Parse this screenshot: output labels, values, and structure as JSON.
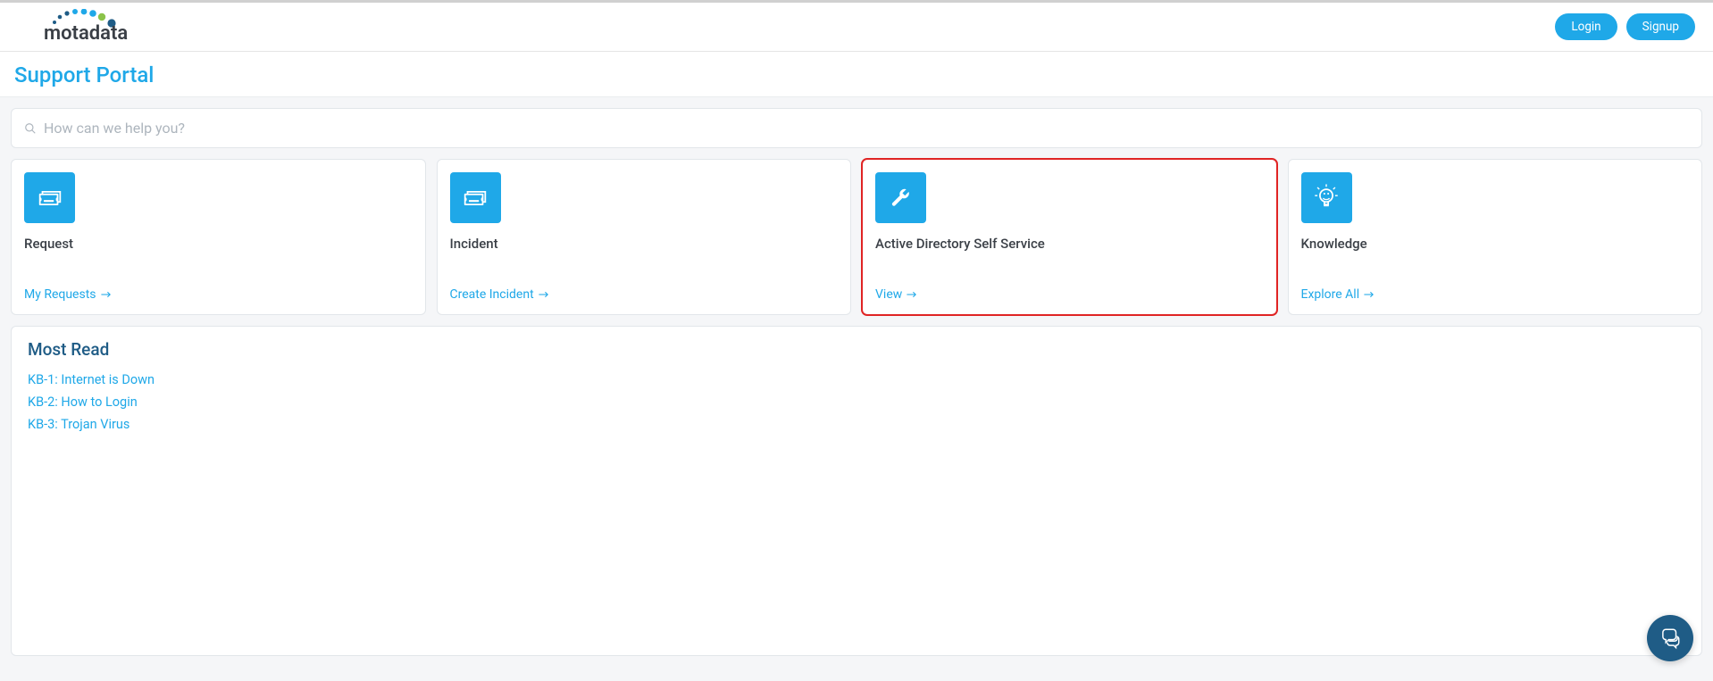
{
  "header": {
    "logo_text": "motadata",
    "login_label": "Login",
    "signup_label": "Signup"
  },
  "page": {
    "title": "Support Portal"
  },
  "search": {
    "placeholder": "How can we help you?"
  },
  "cards": [
    {
      "title": "Request",
      "link_label": "My Requests",
      "icon": "ticket"
    },
    {
      "title": "Incident",
      "link_label": "Create Incident",
      "icon": "ticket"
    },
    {
      "title": "Active Directory Self Service",
      "link_label": "View",
      "icon": "wrench",
      "highlighted": true
    },
    {
      "title": "Knowledge",
      "link_label": "Explore All",
      "icon": "lightbulb"
    }
  ],
  "most_read": {
    "title": "Most Read",
    "items": [
      "KB-1: Internet is Down",
      "KB-2: How to Login",
      "KB-3: Trojan Virus"
    ]
  }
}
